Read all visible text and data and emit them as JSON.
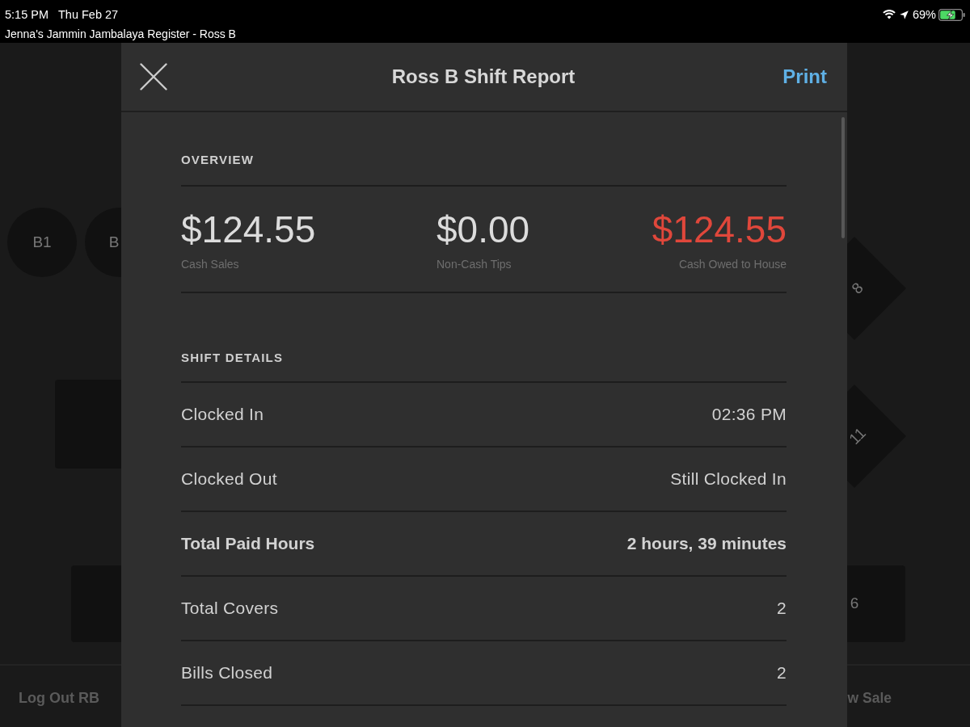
{
  "status_bar": {
    "time": "5:15 PM",
    "date": "Thu Feb 27",
    "battery": "69%"
  },
  "app_title": "Jenna's Jammin Jambalaya Register - Ross B",
  "floor_plan": {
    "tables": [
      {
        "kind": "circle",
        "label": "B1"
      },
      {
        "kind": "circle",
        "label": "B"
      },
      {
        "kind": "square"
      },
      {
        "kind": "square"
      },
      {
        "kind": "diamond",
        "label": "8"
      },
      {
        "kind": "diamond",
        "label": "11"
      },
      {
        "kind": "square",
        "label": "6"
      }
    ]
  },
  "bottom_bar": {
    "left_action": "Log Out RB",
    "right_action": "w Sale"
  },
  "modal": {
    "title": "Ross B Shift Report",
    "action": "Print",
    "overview": {
      "heading": "OVERVIEW",
      "metrics": [
        {
          "value": "$124.55",
          "label": "Cash Sales",
          "warning": false
        },
        {
          "value": "$0.00",
          "label": "Non-Cash Tips",
          "warning": false
        },
        {
          "value": "$124.55",
          "label": "Cash Owed to House",
          "warning": true
        }
      ]
    },
    "shift_details": {
      "heading": "SHIFT DETAILS",
      "rows": [
        {
          "label": "Clocked In",
          "value": "02:36 PM",
          "bold": false
        },
        {
          "label": "Clocked Out",
          "value": "Still Clocked In",
          "bold": false
        },
        {
          "label": "Total Paid Hours",
          "value": "2 hours, 39 minutes",
          "bold": true
        },
        {
          "label": "Total Covers",
          "value": "2",
          "bold": false
        },
        {
          "label": "Bills Closed",
          "value": "2",
          "bold": false
        }
      ]
    }
  }
}
